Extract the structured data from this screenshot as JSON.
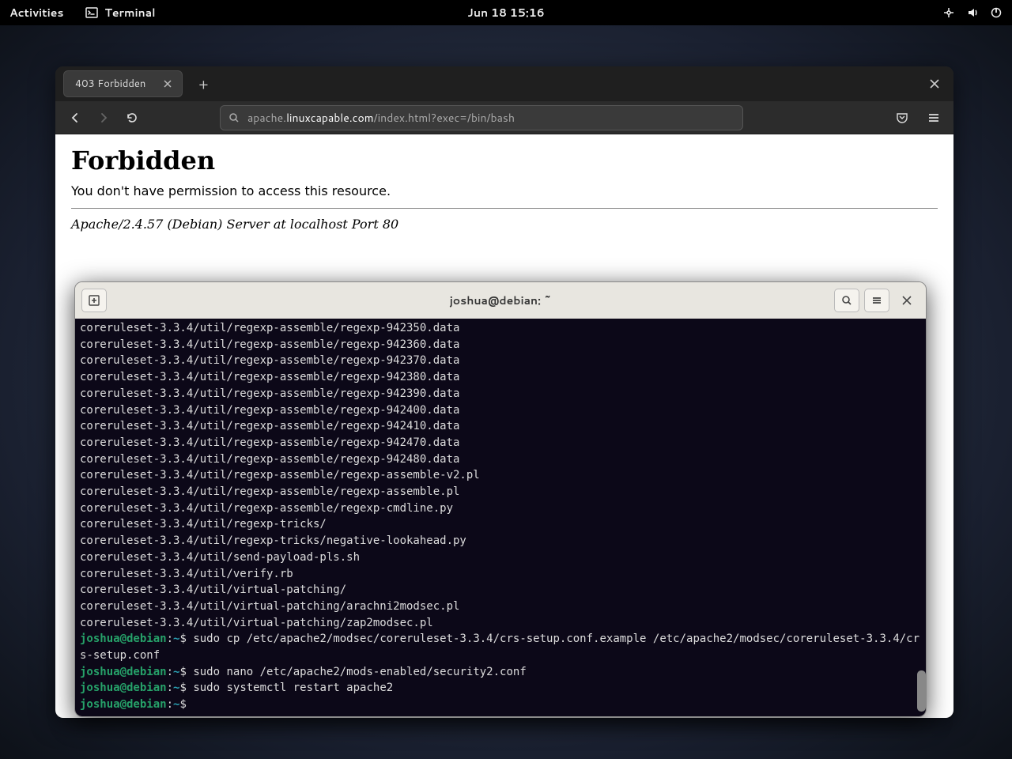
{
  "topbar": {
    "activities": "Activities",
    "app_name": "Terminal",
    "clock": "Jun 18  15:16"
  },
  "browser": {
    "tab_title": "403 Forbidden",
    "url_prefix": "apache.",
    "url_host": "linuxcapable.com",
    "url_rest": "/index.html?exec=/bin/bash",
    "page_heading": "Forbidden",
    "page_message": "You don't have permission to access this resource.",
    "server_sig": "Apache/2.4.57 (Debian) Server at localhost Port 80"
  },
  "terminal": {
    "title": "joshua@debian: ~",
    "user_host": "joshua@debian",
    "path_sym": "~",
    "output_lines": [
      "coreruleset-3.3.4/util/regexp-assemble/regexp-942350.data",
      "coreruleset-3.3.4/util/regexp-assemble/regexp-942360.data",
      "coreruleset-3.3.4/util/regexp-assemble/regexp-942370.data",
      "coreruleset-3.3.4/util/regexp-assemble/regexp-942380.data",
      "coreruleset-3.3.4/util/regexp-assemble/regexp-942390.data",
      "coreruleset-3.3.4/util/regexp-assemble/regexp-942400.data",
      "coreruleset-3.3.4/util/regexp-assemble/regexp-942410.data",
      "coreruleset-3.3.4/util/regexp-assemble/regexp-942470.data",
      "coreruleset-3.3.4/util/regexp-assemble/regexp-942480.data",
      "coreruleset-3.3.4/util/regexp-assemble/regexp-assemble-v2.pl",
      "coreruleset-3.3.4/util/regexp-assemble/regexp-assemble.pl",
      "coreruleset-3.3.4/util/regexp-assemble/regexp-cmdline.py",
      "coreruleset-3.3.4/util/regexp-tricks/",
      "coreruleset-3.3.4/util/regexp-tricks/negative-lookahead.py",
      "coreruleset-3.3.4/util/send-payload-pls.sh",
      "coreruleset-3.3.4/util/verify.rb",
      "coreruleset-3.3.4/util/virtual-patching/",
      "coreruleset-3.3.4/util/virtual-patching/arachni2modsec.pl",
      "coreruleset-3.3.4/util/virtual-patching/zap2modsec.pl"
    ],
    "prompts": [
      "sudo cp /etc/apache2/modsec/coreruleset-3.3.4/crs-setup.conf.example /etc/apache2/modsec/coreruleset-3.3.4/crs-setup.conf",
      "sudo nano /etc/apache2/mods-enabled/security2.conf",
      "sudo systemctl restart apache2",
      ""
    ]
  }
}
